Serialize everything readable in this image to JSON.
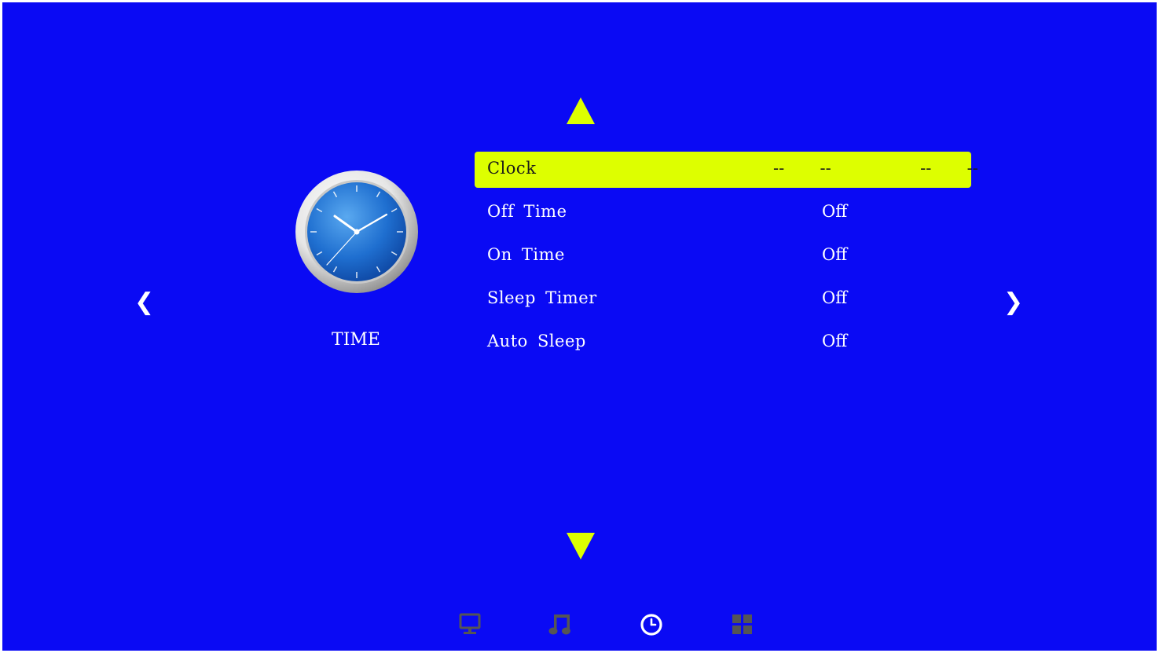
{
  "colors": {
    "background": "#0a0af4",
    "accent": "#ddff00",
    "text": "#ffffff",
    "inactive_icon": "#555555"
  },
  "navigation": {
    "up_icon": "triangle-up-icon",
    "down_icon": "triangle-down-icon",
    "left_icon": "chevron-left-icon",
    "right_icon": "chevron-right-icon",
    "left_glyph": "❮",
    "right_glyph": "❯"
  },
  "section": {
    "icon": "clock-icon",
    "label": "TIME"
  },
  "menu": {
    "selected_index": 0,
    "items": [
      {
        "label": "Clock",
        "value": "--  --     --  --"
      },
      {
        "label": "Off Time",
        "value": "Off"
      },
      {
        "label": "On Time",
        "value": "Off"
      },
      {
        "label": "Sleep Timer",
        "value": "Off"
      },
      {
        "label": "Auto Sleep",
        "value": "Off"
      }
    ]
  },
  "bottom_nav": [
    {
      "icon": "monitor-icon",
      "active": false
    },
    {
      "icon": "music-note-icon",
      "active": false
    },
    {
      "icon": "clock-icon",
      "active": true
    },
    {
      "icon": "grid-icon",
      "active": false
    }
  ]
}
